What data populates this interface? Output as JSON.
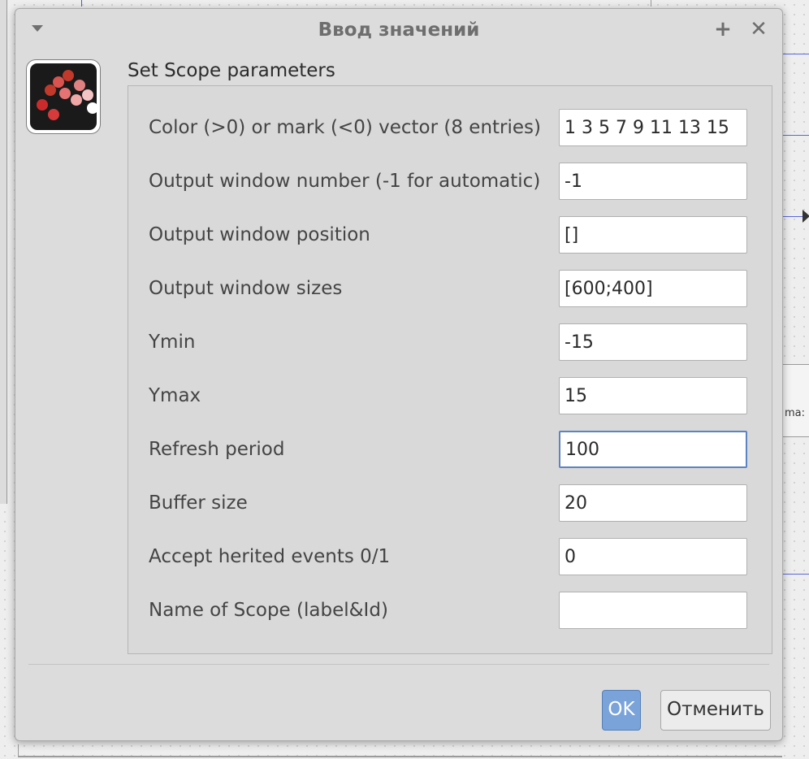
{
  "dialog": {
    "title": "Ввод значений",
    "icons": {
      "menu": "dropdown-arrow-icon",
      "pin": "plus-icon",
      "close": "close-icon",
      "app": "scilab-icon"
    },
    "plus_glyph": "+",
    "close_glyph": "✕"
  },
  "form": {
    "title": "Set Scope parameters",
    "fields": [
      {
        "label": "Color (>0) or mark (<0) vector (8 entries)",
        "value": "1 3 5 7 9 11 13 15"
      },
      {
        "label": "Output window number (-1 for automatic)",
        "value": "-1"
      },
      {
        "label": "Output window position",
        "value": "[]"
      },
      {
        "label": "Output window sizes",
        "value": "[600;400]"
      },
      {
        "label": "Ymin",
        "value": "-15"
      },
      {
        "label": "Ymax",
        "value": "15"
      },
      {
        "label": "Refresh period",
        "value": "100"
      },
      {
        "label": "Buffer size",
        "value": "20"
      },
      {
        "label": "Accept herited events 0/1",
        "value": "0"
      },
      {
        "label": "Name of Scope (label&Id)",
        "value": ""
      }
    ]
  },
  "buttons": {
    "ok": "OK",
    "cancel": "Отменить"
  },
  "background": {
    "block_label": "ma:"
  },
  "colors": {
    "accent": "#7aa3d9",
    "focus": "#5b84c4",
    "dialog_bg": "#dcdcdc"
  }
}
